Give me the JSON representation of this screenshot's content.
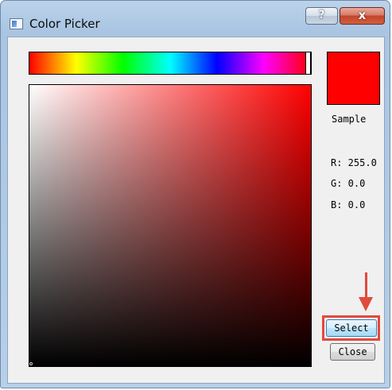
{
  "window": {
    "title": "Color Picker",
    "help_label": "?",
    "close_label": "x"
  },
  "picker": {
    "hue_colors": [
      "#ff0000",
      "#ffff00",
      "#00ff00",
      "#00ffff",
      "#0000ff",
      "#ff00ff",
      "#ff0000"
    ],
    "selected_hue_color": "#ff0000",
    "sample_color": "#ff0000",
    "sample_label": "Sample",
    "r_text": "R: 255.0",
    "g_text": "G: 0.0",
    "b_text": "B: 0.0"
  },
  "buttons": {
    "select_label": "Select",
    "close_label": "Close"
  },
  "annotation": {
    "color": "#e24a3b"
  }
}
